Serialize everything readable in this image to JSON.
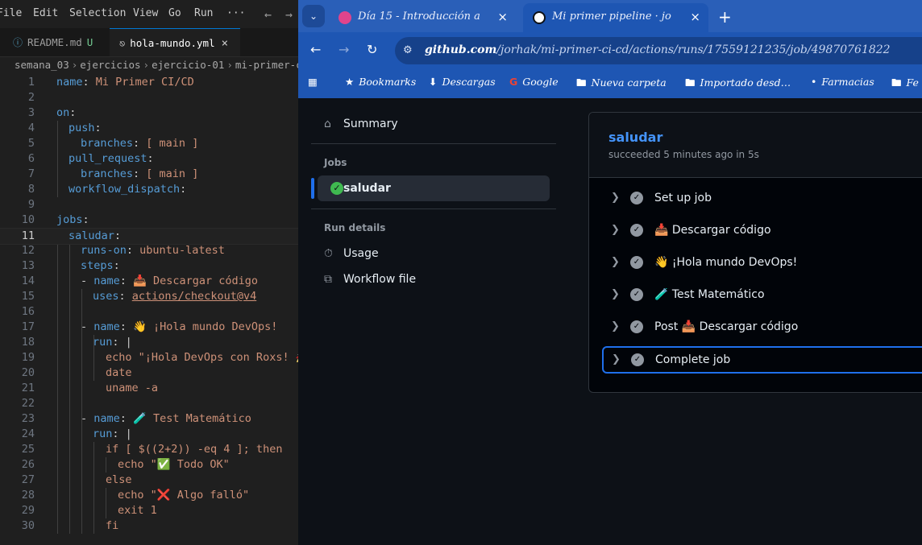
{
  "vscode": {
    "menu": [
      "File",
      "Edit",
      "Selection",
      "View",
      "Go",
      "Run",
      "···"
    ],
    "tabs": [
      {
        "name": "README.md",
        "modified": "U"
      },
      {
        "name": "hola-mundo.yml",
        "close": "×"
      }
    ],
    "breadcrumb": [
      "semana_03",
      "ejercicios",
      "ejercicio-01",
      "mi-primer-ci"
    ],
    "line_numbers": [
      "1",
      "2",
      "3",
      "4",
      "5",
      "6",
      "7",
      "8",
      "9",
      "10",
      "11",
      "12",
      "13",
      "14",
      "15",
      "16",
      "17",
      "18",
      "19",
      "20",
      "21",
      "22",
      "23",
      "24",
      "25",
      "26",
      "27",
      "28",
      "29",
      "30"
    ],
    "current_line": "11",
    "code": {
      "l1_key": "name",
      "l1_val": "Mi Primer CI/CD",
      "l3_key": "on",
      "l4_key": "push",
      "l5_key": "branches",
      "l5_val": "[ main ]",
      "l6_key": "pull_request",
      "l7_key": "branches",
      "l7_val": "[ main ]",
      "l8_key": "workflow_dispatch",
      "l10_key": "jobs",
      "l11_key": "saludar",
      "l12_key": "runs-on",
      "l12_val": "ubuntu-latest",
      "l13_key": "steps",
      "l14_key": "name",
      "l14_val": "📥 Descargar código",
      "l15_key": "uses",
      "l15_val": "actions/checkout@v4",
      "l17_key": "name",
      "l17_val": "👋 ¡Hola mundo DevOps!",
      "l18_key": "run",
      "l18_val": "|",
      "l19": "echo \"¡Hola DevOps con Roxs! 🚀",
      "l20": "date",
      "l21": "uname -a",
      "l23_key": "name",
      "l23_val": "🧪 Test Matemático",
      "l24_key": "run",
      "l24_val": "|",
      "l25": "if [ $((2+2)) -eq 4 ]; then",
      "l26": "echo \"✅ Todo OK\"",
      "l27": "else",
      "l28": "echo \"❌ Algo falló\"",
      "l29": "exit 1",
      "l30": "fi"
    }
  },
  "chrome": {
    "tabs": [
      {
        "title": "Día 15 - Introducción a",
        "close": "×"
      },
      {
        "title": "Mi primer pipeline · jo",
        "close": "×"
      }
    ],
    "new_tab": "+",
    "url_host": "github.com",
    "url_path": "/jorhak/mi-primer-ci-cd/actions/runs/17559121235/job/49870761822",
    "bookmarks": [
      {
        "label": "Bookmarks",
        "icon": "star-icon"
      },
      {
        "label": "Descargas",
        "icon": "download-icon"
      },
      {
        "label": "Google",
        "icon": "google-icon"
      },
      {
        "label": "Nueva carpeta",
        "icon": "folder-icon"
      },
      {
        "label": "Importado desd…",
        "icon": "folder-icon"
      },
      {
        "label": "Farmacias",
        "icon": "pin-icon"
      },
      {
        "label": "Fe",
        "icon": "folder-icon"
      }
    ]
  },
  "github": {
    "sidebar": {
      "summary": "Summary",
      "jobs_heading": "Jobs",
      "job_item": "saludar",
      "run_details_heading": "Run details",
      "usage": "Usage",
      "workflow_file": "Workflow file"
    },
    "job": {
      "title": "saludar",
      "subtitle": "succeeded 5 minutes ago in 5s",
      "steps": [
        "Set up job",
        "📥 Descargar código",
        "👋 ¡Hola mundo DevOps!",
        "🧪 Test Matemático",
        "Post 📥 Descargar código",
        "Complete job"
      ]
    },
    "colors": {
      "link": "#4493f8",
      "success": "#3fb950",
      "accent": "#1f6feb"
    }
  }
}
